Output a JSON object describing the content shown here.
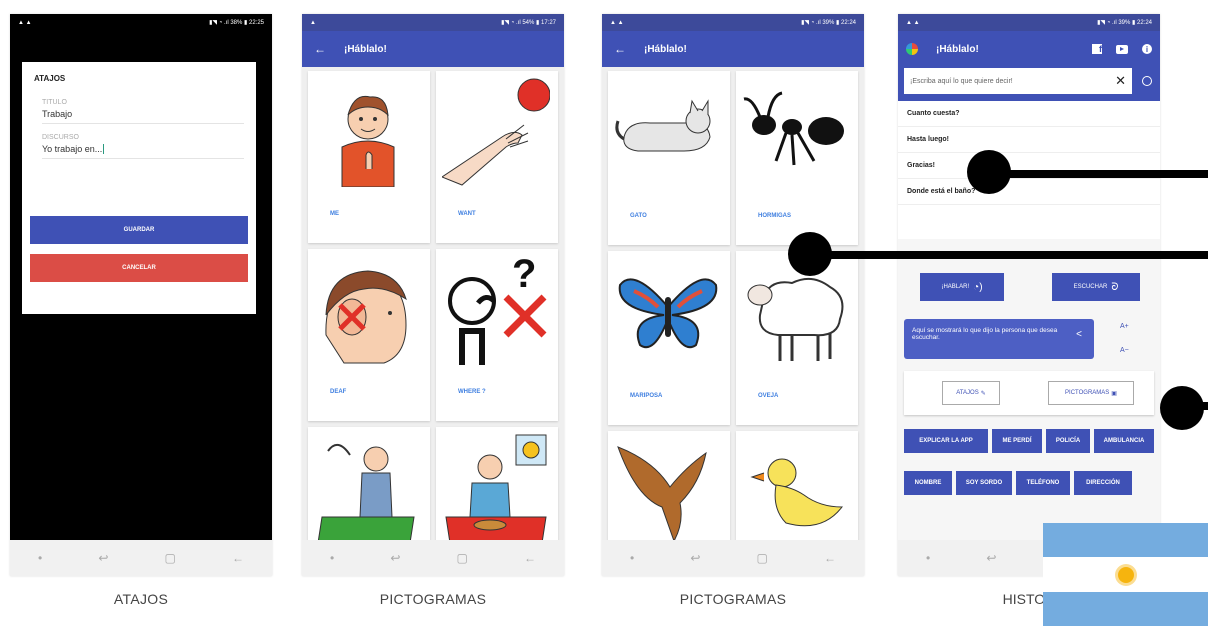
{
  "p1": {
    "status": {
      "left": "▲ ▲",
      "right": "▮◥ ◔ .ıl 38% ▮ 22:25"
    },
    "dialog": {
      "title": "ATAJOS",
      "titulo_label": "TITULO",
      "titulo_value": "Trabajo",
      "discurso_label": "DISCURSO",
      "discurso_value": "Yo trabajo en...",
      "guardar": "GUARDAR",
      "cancelar": "CANCELAR"
    },
    "caption": "ATAJOS"
  },
  "p2": {
    "status": {
      "left": "▲",
      "right": "▮◥ ◔ .ıl 54% ▮ 17:27"
    },
    "title": "¡Háblalo!",
    "cards": [
      "ME",
      "WANT",
      "DEAF",
      "WHERE ?",
      "",
      ""
    ],
    "caption": "PICTOGRAMAS"
  },
  "p3": {
    "status": {
      "left": "▲ ▲",
      "right": "▮◥ ◔ .ıl 39% ▮ 22:24"
    },
    "title": "¡Háblalo!",
    "cards": [
      "GATO",
      "HORMIGAS",
      "MARIPOSA",
      "OVEJA",
      "",
      ""
    ],
    "caption": "PICTOGRAMAS"
  },
  "p4": {
    "status": {
      "left": "▲ ▲",
      "right": "▮◥ ◔ .ıl 39% ▮ 22:24"
    },
    "title": "¡Háblalo!",
    "search_placeholder": "¡Escriba aquí lo que quiere decir!",
    "history": [
      "Cuanto cuesta?",
      "Hasta luego!",
      "Gracias!",
      "Donde está el baño?"
    ],
    "hablar": "¡HABLAR!",
    "escuchar": "ESCUCHAR",
    "message": "Aquí se mostrará lo que dijo la persona que desea escuchar.",
    "font_up": "A+",
    "font_down": "A−",
    "atajos": "ATAJOS",
    "pictogramas": "PICTOGRAMAS",
    "shortcuts": [
      "EXPLICAR LA APP",
      "ME PERDÍ",
      "POLICÍA",
      "AMBULANCIA",
      "NOMBRE",
      "SOY SORDO",
      "TELÉFONO",
      "DIRECCIÓN"
    ],
    "caption": "HISTOR"
  },
  "nav": {
    "dot": "•",
    "recent": "↩",
    "home": "▢",
    "back": "←"
  },
  "colors": {
    "primary": "#3f51b5",
    "status": "#3d4a9a",
    "danger": "#db4d46",
    "link": "#3f7fe0",
    "flag_blue": "#74acdf",
    "flag_sun": "#f6b40e"
  }
}
